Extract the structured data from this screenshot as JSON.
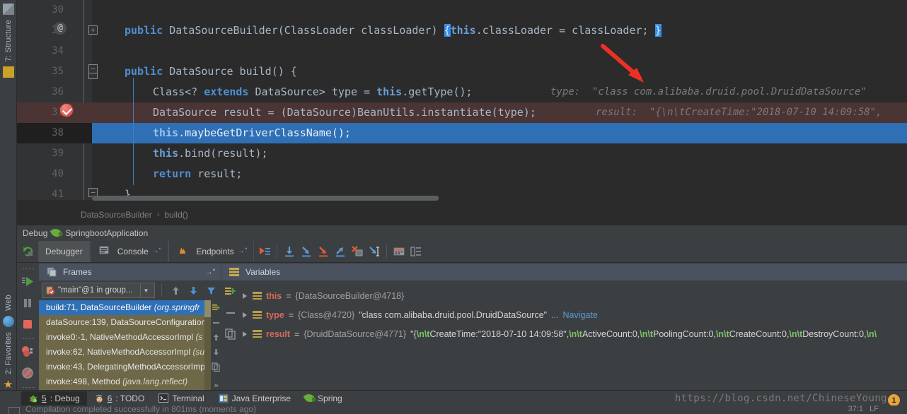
{
  "rail": {
    "items": [
      {
        "label": "7: Structure",
        "icon": "structure-icon"
      },
      {
        "label": "Web",
        "icon": "web-icon"
      },
      {
        "label": "2: Favorites",
        "icon": "star-icon"
      }
    ]
  },
  "editor": {
    "lines": [
      {
        "num": "30",
        "text": ""
      },
      {
        "num": "31",
        "text": "public DataSourceBuilder(ClassLoader classLoader) { this.classLoader = classLoader; }"
      },
      {
        "num": "34",
        "text": ""
      },
      {
        "num": "35",
        "text": "public DataSource build() {"
      },
      {
        "num": "36",
        "text": "Class<? extends DataSource> type = this.getType();"
      },
      {
        "num": "37",
        "text": "DataSource result = (DataSource)BeanUtils.instantiate(type);"
      },
      {
        "num": "38",
        "text": "this.maybeGetDriverClassName();"
      },
      {
        "num": "39",
        "text": "this.bind(result);"
      },
      {
        "num": "40",
        "text": "return result;"
      },
      {
        "num": "41",
        "text": "}"
      }
    ],
    "tokens": {
      "kw_public": "public",
      "kw_extends": "extends",
      "kw_return": "return",
      "kw_this": "this",
      "ctor_sig": " DataSourceBuilder(ClassLoader classLoader) ",
      "brace_open": "{",
      "brace_close": "}",
      "ctor_body": ".classLoader = classLoader; ",
      "build_sig": " DataSource build() {",
      "line36_a": "Class<? ",
      "line36_b": " DataSource> type = ",
      "line36_c": ".getType();",
      "line37_a": "DataSource result = (DataSource)BeanUtils.instantiate(type);",
      "line38_b": ".maybeGetDriverClassName();",
      "line39_b": ".bind(result);",
      "line40_b": " result;",
      "line41": "}"
    },
    "hints": {
      "line36": "type:  \"class com.alibaba.druid.pool.DruidDataSource\"",
      "line37": "result:  \"{\\n\\tCreateTime:\"2018-07-10 14:09:58\","
    },
    "gutter": {
      "annotation": "@",
      "fold_plus": "+",
      "fold_minus": "−"
    }
  },
  "breadcrumb": {
    "items": [
      "DataSourceBuilder",
      "build()"
    ],
    "separator": "›"
  },
  "debug_window": {
    "title": "Debug",
    "config_name": "SpringbootApplication",
    "toolbar": {
      "rerun": "rerun-icon",
      "tabs": [
        {
          "label": "Debugger",
          "icon": "",
          "active": true
        },
        {
          "label": "Console",
          "icon": "console-icon",
          "pin": "→ʺ",
          "active": false
        },
        {
          "label": "Endpoints",
          "icon": "endpoints-icon",
          "pin": "→ʺ",
          "active": false
        }
      ],
      "actions": [
        "show-execution-point-icon",
        "step-over-icon",
        "step-into-icon",
        "force-step-into-icon",
        "step-out-icon",
        "drop-frame-icon",
        "run-to-cursor-icon",
        "evaluate-expression-icon",
        "layout-icon"
      ]
    },
    "left_actions": [
      "resume-program-icon",
      "pause-program-icon",
      "stop-icon",
      "view-breakpoints-icon",
      "mute-breakpoints-icon",
      "more-icon"
    ]
  },
  "frames": {
    "title": "Frames",
    "settings_icon": "→ʺ",
    "thread": "\"main\"@1 in group...",
    "thread_icon": "thread-suspended-icon",
    "actions": [
      "move-up-icon",
      "move-down-icon",
      "filter-icon"
    ],
    "rows": [
      {
        "method": "build:71, DataSourceBuilder ",
        "pkg": "(org.springfr",
        "selected": true
      },
      {
        "method": "dataSource:139, DataSourceConfiguration",
        "pkg": "",
        "selected": false
      },
      {
        "method": "invoke0:-1, NativeMethodAccessorImpl ",
        "pkg": "(s",
        "selected": false
      },
      {
        "method": "invoke:62, NativeMethodAccessorImpl ",
        "pkg": "(su",
        "selected": false
      },
      {
        "method": "invoke:43, DelegatingMethodAccessorImp",
        "pkg": "",
        "selected": false
      },
      {
        "method": "invoke:498, Method ",
        "pkg": "(java.lang.reflect)",
        "selected": false
      }
    ],
    "side_actions": [
      "customize-icon",
      "remove-icon",
      "up-icon",
      "down-icon",
      "copy-icon",
      "more-icon"
    ]
  },
  "variables": {
    "title": "Variables",
    "rail_actions": [
      "new-watch-icon",
      "remove-watch-icon",
      "copy-value-icon"
    ],
    "rows": [
      {
        "name": "this",
        "eq": " = ",
        "ref": "{DataSourceBuilder@4718}",
        "value": "",
        "escaped": [],
        "link": ""
      },
      {
        "name": "type",
        "eq": " = ",
        "ref": "{Class@4720}",
        "value": " \"class com.alibaba.druid.pool.DruidDataSource\"",
        "ellipsis": " ... ",
        "link": "Navigate",
        "escaped": []
      },
      {
        "name": "result",
        "eq": " = ",
        "ref": "{DruidDataSource@4771}",
        "value_parts": [
          {
            "t": " \"{",
            "esc": false
          },
          {
            "t": "\\n\\t",
            "esc": true
          },
          {
            "t": "CreateTime:\"2018-07-10 14:09:58\",",
            "esc": false
          },
          {
            "t": "\\n\\t",
            "esc": true
          },
          {
            "t": "ActiveCount:0,",
            "esc": false
          },
          {
            "t": "\\n\\t",
            "esc": true
          },
          {
            "t": "PoolingCount:0,",
            "esc": false
          },
          {
            "t": "\\n\\t",
            "esc": true
          },
          {
            "t": "CreateCount:0,",
            "esc": false
          },
          {
            "t": "\\n\\t",
            "esc": true
          },
          {
            "t": "DestroyCount:0,",
            "esc": false
          },
          {
            "t": "\\n\\",
            "esc": true
          }
        ],
        "link": ""
      }
    ]
  },
  "status_bar": {
    "tabs": [
      {
        "num": "5",
        "label": ": Debug",
        "icon": "debug-bug-icon",
        "active": true
      },
      {
        "num": "6",
        "label": ": TODO",
        "icon": "todo-icon",
        "active": false
      },
      {
        "num": "",
        "label": "Terminal",
        "icon": "terminal-icon",
        "active": false
      },
      {
        "num": "",
        "label": "Java Enterprise",
        "icon": "java-enterprise-icon",
        "active": false
      },
      {
        "num": "",
        "label": "Spring",
        "icon": "spring-leaf-icon",
        "active": false
      }
    ],
    "compile_message": "Compilation completed successfully in 801ms (moments ago)",
    "caret_position": "37:1",
    "line_sep": "LF",
    "watermark": "https://blog.csdn.net/ChineseYoung",
    "warning_count": "1"
  },
  "colors": {
    "editor_bg": "#2b2b2b",
    "gutter_bg": "#313335",
    "panel_bg": "#3c3f41",
    "selection_blue": "#2f6fb5",
    "breakpoint_row": "#4b3434",
    "frames_bg": "#6e6849",
    "accent_red": "#d6685f",
    "keyword_blue": "#4e8fd4",
    "escape_green": "#7ec36b",
    "arrow_red": "#ee2f25"
  }
}
